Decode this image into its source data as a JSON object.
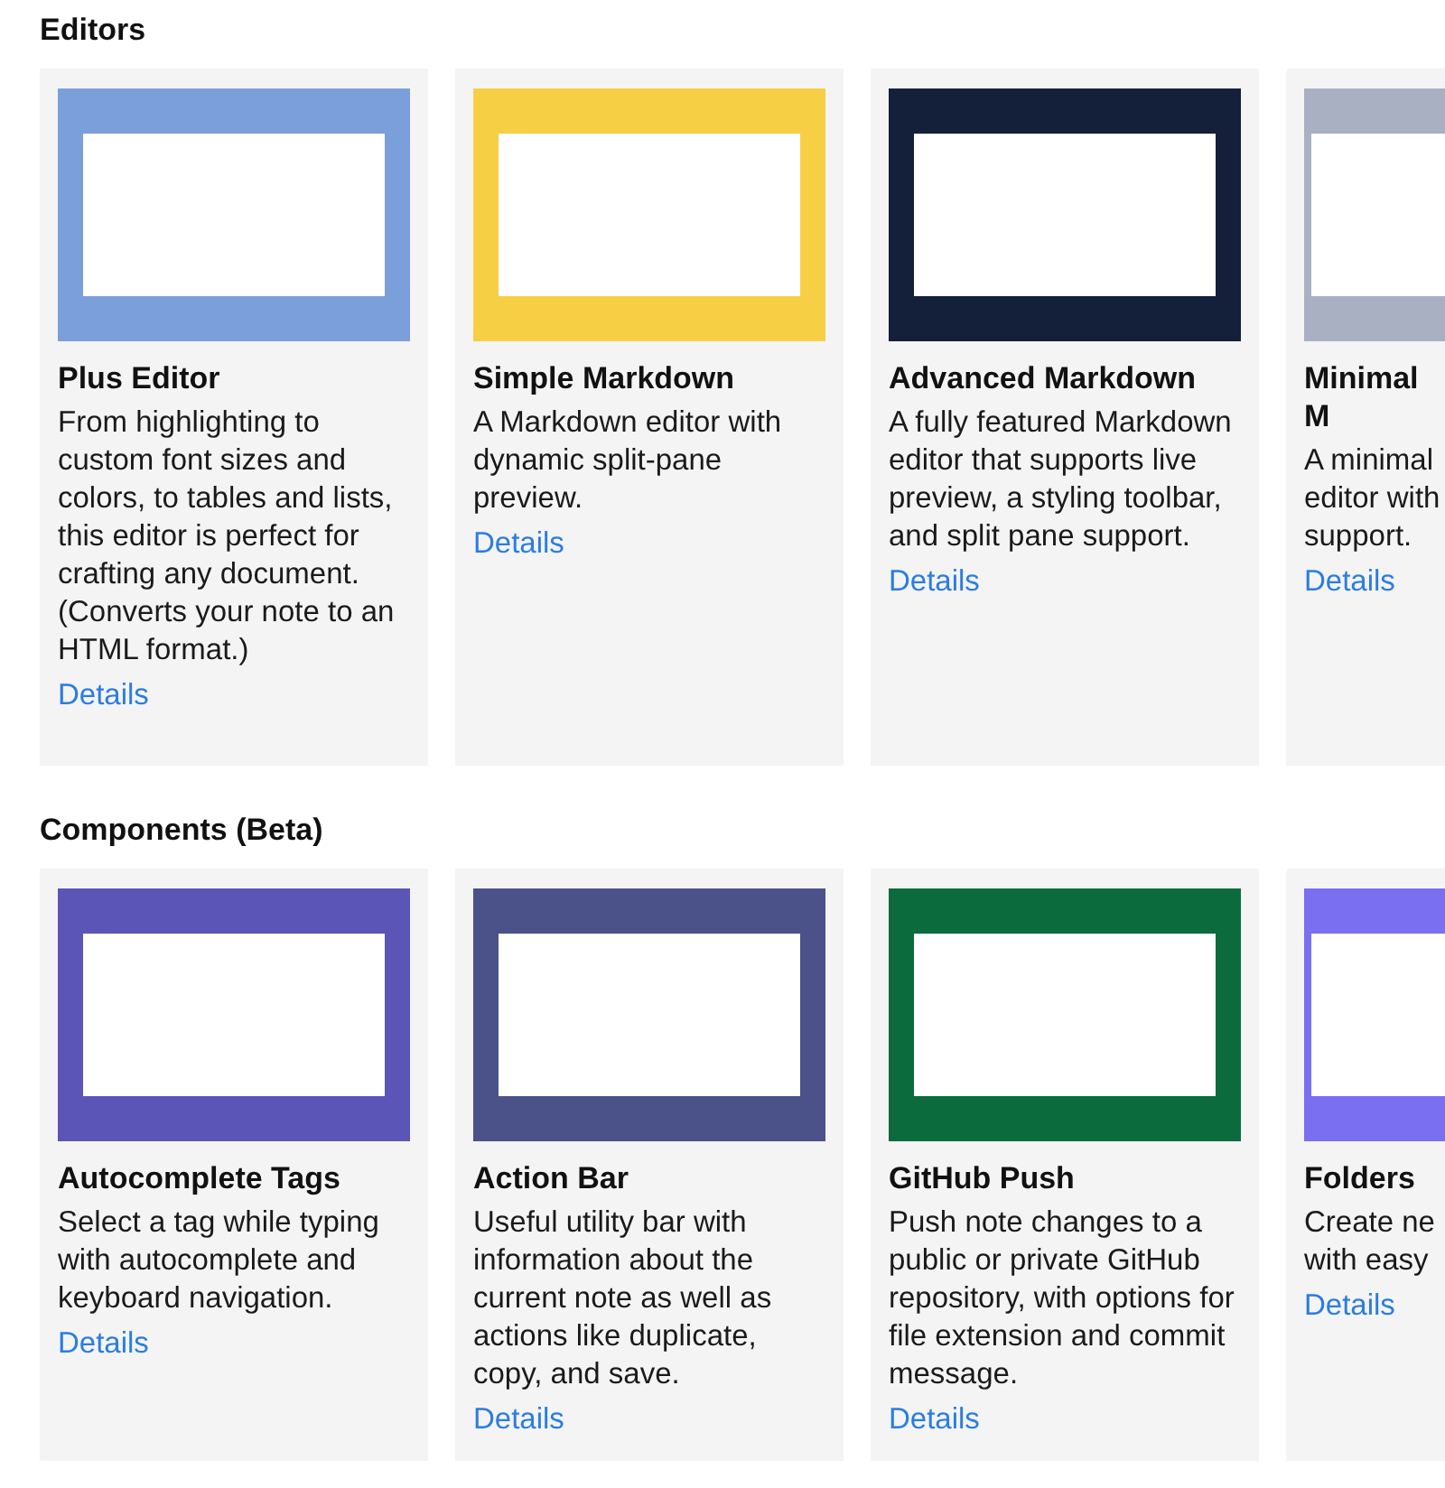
{
  "sections": [
    {
      "title": "Editors",
      "cards": [
        {
          "title": "Plus Editor",
          "description": "From highlighting to custom font sizes and colors, to tables and lists, this editor is perfect for crafting any document. (Converts your note to an HTML format.)",
          "link": "Details",
          "color": "#7b9fdb"
        },
        {
          "title": "Simple Markdown",
          "description": "A Markdown editor with dynamic split-pane preview.",
          "link": "Details",
          "color": "#f7cf45"
        },
        {
          "title": "Advanced Markdown",
          "description": "A fully featured Markdown editor that supports live preview, a styling toolbar, and split pane support.",
          "link": "Details",
          "color": "#14203a"
        },
        {
          "title": "Minimal M",
          "description": "A minimal editor with support.",
          "link": "Details",
          "color": "#a9b0c2"
        }
      ]
    },
    {
      "title": "Components (Beta)",
      "cards": [
        {
          "title": "Autocomplete Tags",
          "description": "Select a tag while typing with autocomplete and keyboard navigation.",
          "link": "Details",
          "color": "#5b55b8"
        },
        {
          "title": "Action Bar",
          "description": "Useful utility bar with information about the current note as well as actions like duplicate, copy, and save.",
          "link": "Details",
          "color": "#4a5289"
        },
        {
          "title": "GitHub Push",
          "description": "Push note changes to a public or private GitHub repository, with options for file extension and commit message.",
          "link": "Details",
          "color": "#0b6b3d"
        },
        {
          "title": "Folders",
          "description": "Create ne with easy",
          "link": "Details",
          "color": "#7a6ff0"
        }
      ]
    }
  ]
}
